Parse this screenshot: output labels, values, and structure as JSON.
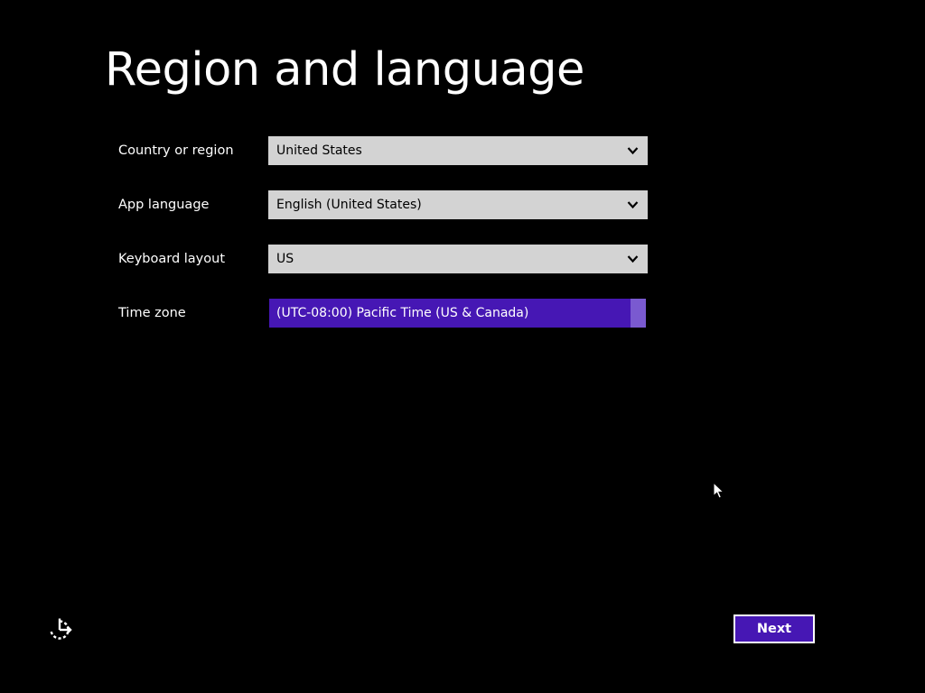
{
  "page": {
    "title": "Region and language"
  },
  "fields": {
    "country": {
      "label": "Country or region",
      "value": "United States"
    },
    "app_language": {
      "label": "App language",
      "value": "English (United States)"
    },
    "keyboard_layout": {
      "label": "Keyboard layout",
      "value": "US"
    },
    "time_zone": {
      "label": "Time zone",
      "value": "(UTC-08:00) Pacific Time (US & Canada)"
    }
  },
  "buttons": {
    "next_label": "Next"
  },
  "icons": {
    "ease_of_access": "ease-of-access-icon",
    "dropdown_arrow": "chevron-down-icon",
    "pointer": "mouse-pointer-icon"
  },
  "colors": {
    "background": "#000000",
    "accent": "#4617b4",
    "accent_light": "#7a5ad0",
    "dropdown_bg": "#d3d3d3",
    "text": "#ffffff"
  }
}
